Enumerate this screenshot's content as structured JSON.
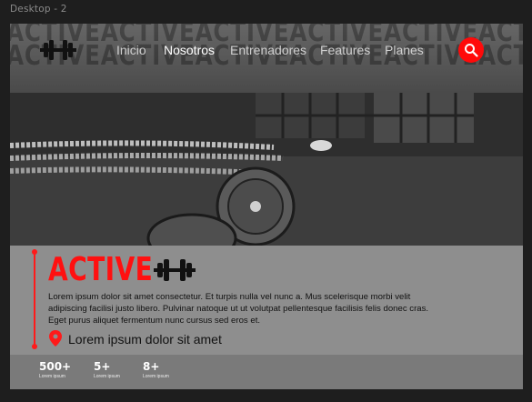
{
  "frame_label": "Desktop - 2",
  "header": {
    "background_word_row1": "ACTIVEACTIVEACTIVEACTIVEACTIVEACTIVE",
    "background_word_row2": "ACTIVEACTIVEACTIVEACTIVEACTIVEACTIVE",
    "logo_icon": "dumbbell-icon",
    "nav": [
      {
        "label": "Inicio",
        "active": false
      },
      {
        "label": "Nosotros",
        "active": true
      },
      {
        "label": "Entrenadores",
        "active": false
      },
      {
        "label": "Features",
        "active": false
      },
      {
        "label": "Planes",
        "active": false
      }
    ],
    "search_icon": "search-icon",
    "search_bg": "#ff0a0a"
  },
  "hero": {
    "image_subject": "barbell-on-gym-floor-icon"
  },
  "info": {
    "title": "ACTIVE",
    "title_color": "#ff1010",
    "description": "Lorem ipsum dolor sit amet consectetur. Et turpis nulla vel nunc a. Mus scelerisque morbi velit adipiscing facilisi justo libero. Pulvinar natoque ut ut volutpat pellentesque facilisis felis donec cras. Eget purus aliquet fermentum nunc cursus sed eros et.",
    "location_icon": "map-pin-icon",
    "location": "Lorem ipsum dolor sit amet"
  },
  "stats": [
    {
      "value": "500+",
      "caption": "Lorem ipsum"
    },
    {
      "value": "5+",
      "caption": "Lorem ipsum"
    },
    {
      "value": "8+",
      "caption": "Lorem ipsum"
    }
  ]
}
